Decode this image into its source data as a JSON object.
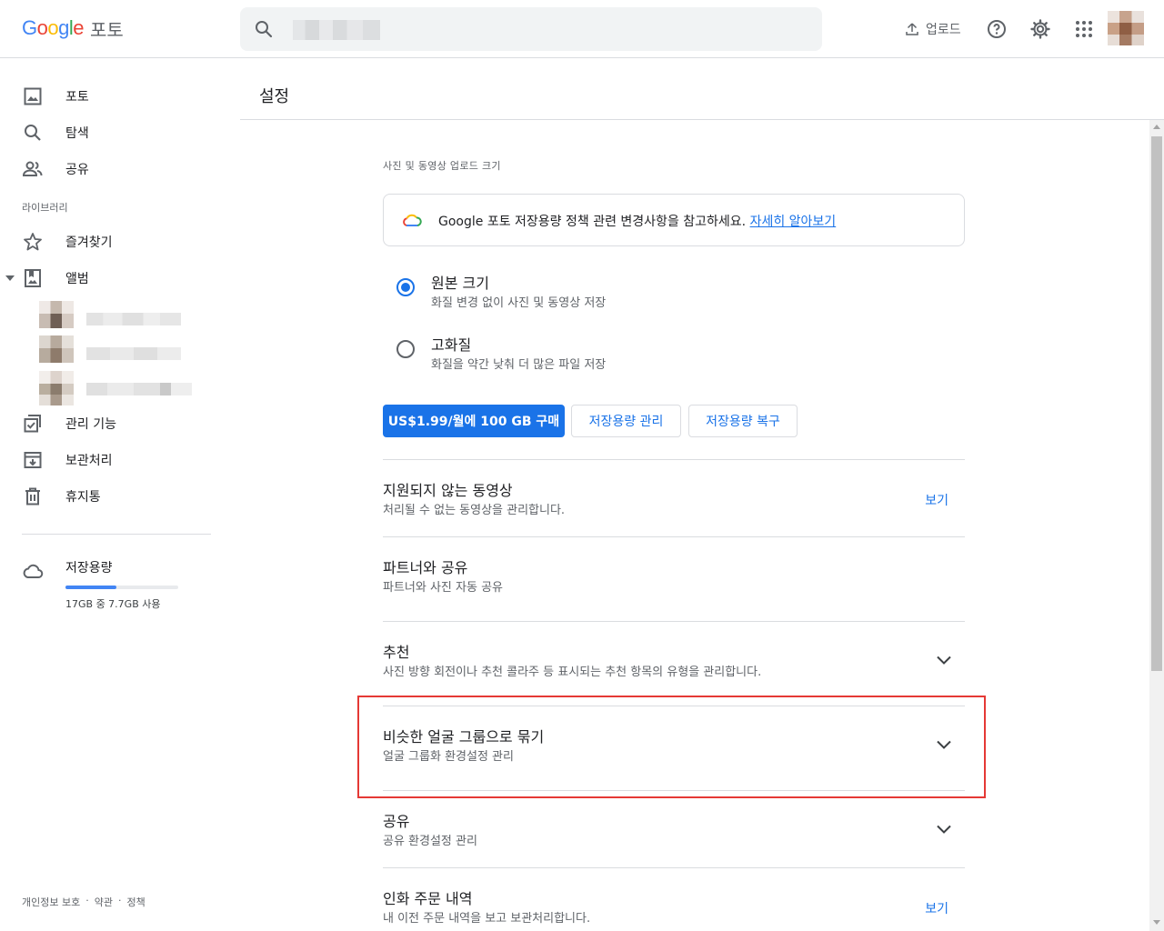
{
  "app": {
    "logo_text": "Google",
    "product_name": "포토",
    "colors": {
      "blue": "#4285F4",
      "red": "#EA4335",
      "yellow": "#FBBC05",
      "green": "#34A853",
      "accent": "#1a73e8",
      "highlight_box": "#e53935"
    }
  },
  "topbar": {
    "search_icon": "search-icon",
    "upload_label": "업로드",
    "help_icon": "help-icon",
    "settings_icon": "gear-icon",
    "apps_icon": "apps-grid-icon"
  },
  "sidebar": {
    "items": [
      {
        "label": "포토",
        "icon": "photo-icon"
      },
      {
        "label": "탐색",
        "icon": "search-icon"
      },
      {
        "label": "공유",
        "icon": "people-icon"
      }
    ],
    "library_label": "라이브러리",
    "library_items": [
      {
        "label": "즐겨찾기",
        "icon": "star-icon"
      },
      {
        "label": "앨범",
        "icon": "album-icon"
      }
    ],
    "tools": [
      {
        "label": "관리 기능",
        "icon": "checklist-icon"
      },
      {
        "label": "보관처리",
        "icon": "archive-icon"
      },
      {
        "label": "휴지통",
        "icon": "trash-icon"
      }
    ],
    "storage": {
      "label": "저장용량",
      "usage_text": "17GB 중 7.7GB 사용",
      "fill_fraction": 0.45,
      "icon": "cloud-icon"
    },
    "footer": {
      "privacy": "개인정보 보호",
      "sep": "·",
      "terms": "약관",
      "policy": "정책"
    }
  },
  "main": {
    "title": "설정",
    "upload_size_heading": "사진 및 동영상 업로드 크기",
    "banner": {
      "text": "Google 포토 저장용량 정책 관련 변경사항을 참고하세요.",
      "link": "자세히 알아보기"
    },
    "options": [
      {
        "title": "원본 크기",
        "subtitle": "화질 변경 없이 사진 및 동영상 저장",
        "selected": true
      },
      {
        "title": "고화질",
        "subtitle": "화질을 약간 낮춰 더 많은 파일 저장",
        "selected": false
      }
    ],
    "buttons": {
      "buy": "US$1.99/월에 100 GB 구매",
      "manage": "저장용량 관리",
      "recover": "저장용량 복구"
    },
    "rows": [
      {
        "title": "지원되지 않는 동영상",
        "subtitle": "처리될 수 없는 동영상을 관리합니다.",
        "action": "보기"
      },
      {
        "title": "파트너와 공유",
        "subtitle": "파트너와 사진 자동 공유"
      },
      {
        "title": "추천",
        "subtitle": "사진 방향 회전이나 추천 콜라주 등 표시되는 추천 항목의 유형을 관리합니다."
      },
      {
        "title": "비슷한 얼굴 그룹으로 묶기",
        "subtitle": "얼굴 그룹화 환경설정 관리"
      },
      {
        "title": "공유",
        "subtitle": "공유 환경설정 관리"
      },
      {
        "title": "인화 주문 내역",
        "subtitle": "내 이전 주문 내역을 보고 보관처리합니다.",
        "action": "보기"
      }
    ]
  }
}
